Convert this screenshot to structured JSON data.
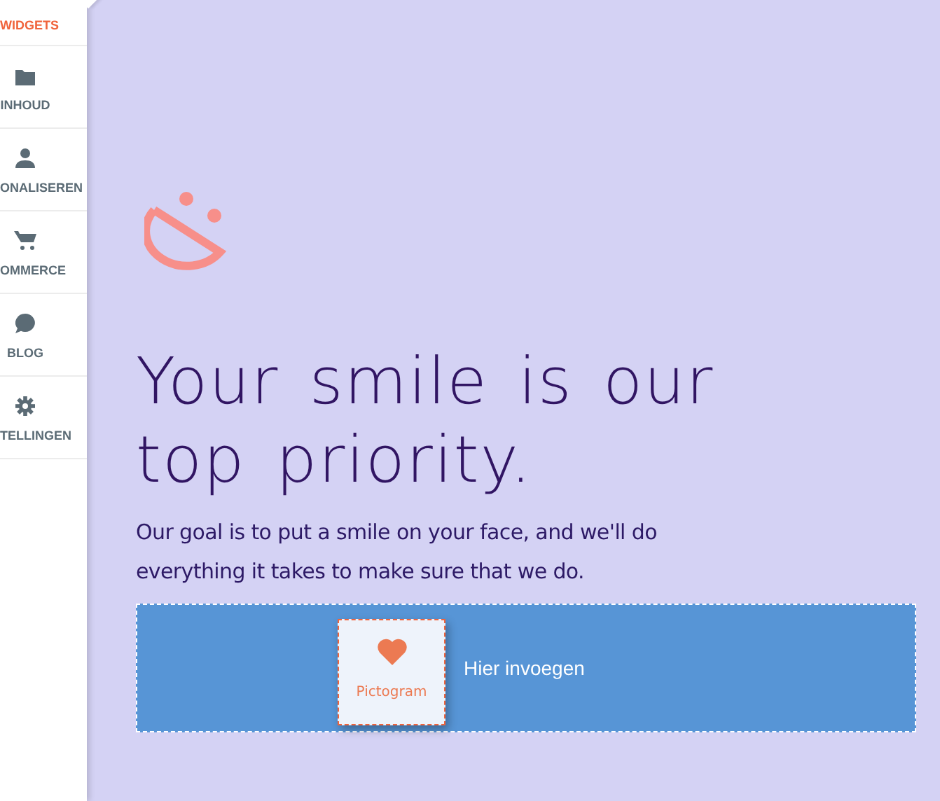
{
  "sidebar": {
    "items": [
      {
        "label": "WIDGETS",
        "kind": "widgets",
        "selected": true
      },
      {
        "label": "INHOUD",
        "kind": "folder",
        "selected": false
      },
      {
        "label": "ONALISEREN",
        "kind": "person",
        "selected": false
      },
      {
        "label": "OMMERCE",
        "kind": "cart",
        "selected": false
      },
      {
        "label": "BLOG",
        "kind": "chat",
        "selected": false
      },
      {
        "label": "TELLINGEN",
        "kind": "gear",
        "selected": false
      }
    ]
  },
  "hero": {
    "heading_lines": [
      "Your smile is our",
      "top priority."
    ],
    "text": "Our goal is to put a smile on your face, and we'll do everything it takes to make sure that we do."
  },
  "dropzone": {
    "widget": {
      "label": "Pictogram"
    },
    "hint": "Hier invoegen"
  }
}
